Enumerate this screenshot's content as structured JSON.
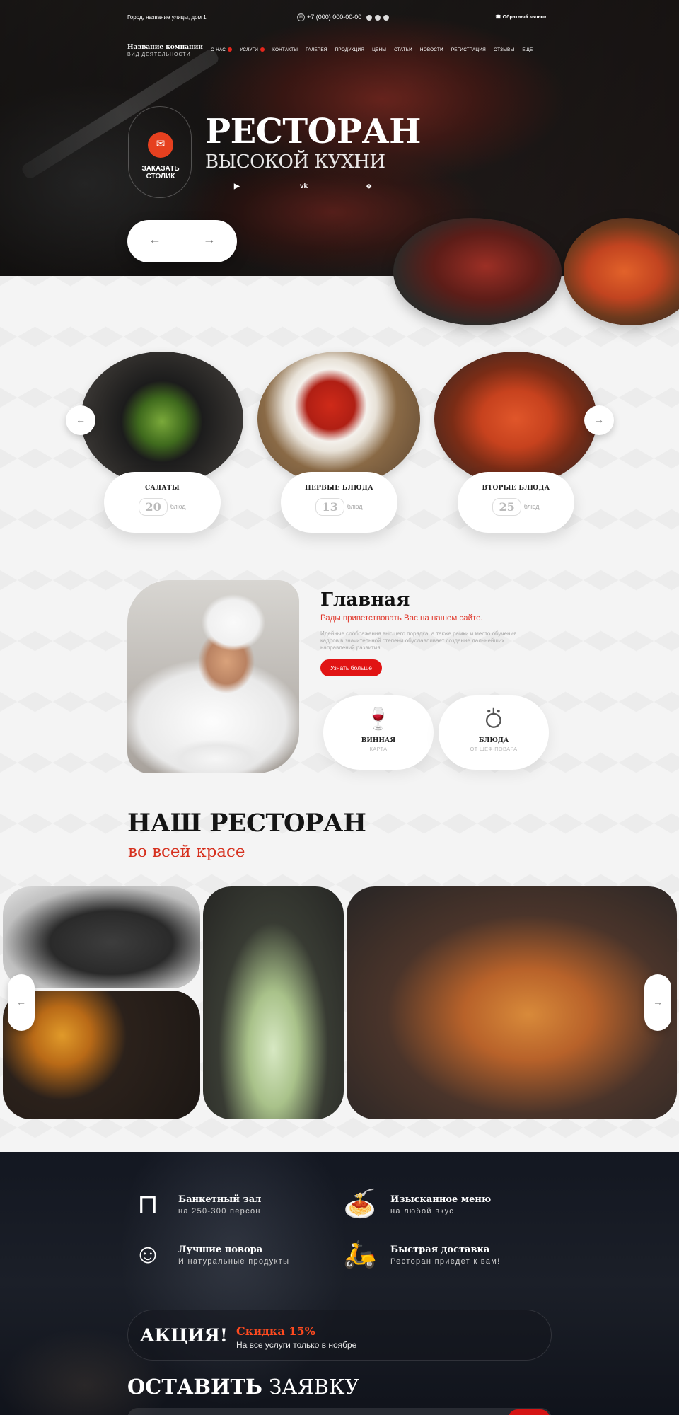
{
  "topbar": {
    "address": "Город, название улицы, дом 1",
    "phone": "+7 (000) 000-00-00",
    "callback": "Обратный звонок"
  },
  "brand": {
    "name": "Название компании",
    "kind": "ВИД ДЕЯТЕЛЬНОСТИ"
  },
  "nav": [
    "О НАС",
    "УСЛУГИ",
    "КОНТАКТЫ",
    "ГАЛЕРЕЯ",
    "ПРОДУКЦИЯ",
    "ЦЕНЫ",
    "СТАТЬИ",
    "НОВОСТИ",
    "РЕГИСТРАЦИЯ",
    "ОТЗЫВЫ",
    "ЕЩЕ"
  ],
  "hero": {
    "order_label": "ЗАКАЗАТЬ СТОЛИК",
    "title": "РЕСТОРАН",
    "subtitle": "ВЫСОКОЙ КУХНИ",
    "socials": [
      "youtube-icon",
      "vk-icon",
      "odnoklassniki-icon"
    ],
    "social_glyphs": [
      "▶",
      "vk",
      "ꝋ"
    ]
  },
  "categories": [
    {
      "title": "САЛАТЫ",
      "count": "20",
      "unit": "блюд"
    },
    {
      "title": "ПЕРВЫЕ БЛЮДА",
      "count": "13",
      "unit": "блюд"
    },
    {
      "title": "ВТОРЫЕ БЛЮДА",
      "count": "25",
      "unit": "блюд"
    }
  ],
  "about": {
    "title": "Главная",
    "subtitle": "Рады приветствовать Вас на нашем сайте.",
    "text": "Идейные соображения высшего порядка, а также рамки и место обучения кадров в значительной степени обуславливает создание дальнейших направлений развития.",
    "button": "Узнать больше",
    "features": [
      {
        "title": "ВИННАЯ",
        "sub": "КАРТА"
      },
      {
        "title": "БЛЮДА",
        "sub": "ОТ ШЕФ-ПОВАРА"
      }
    ]
  },
  "gallery": {
    "title": "НАШ РЕСТОРАН",
    "subtitle": "во всей красе"
  },
  "advantages": [
    {
      "title": "Банкетный зал",
      "sub": "на 250-300 персон",
      "icon": "banquet-table-icon"
    },
    {
      "title": "Изысканное меню",
      "sub": "на любой вкус",
      "icon": "pasta-plate-icon"
    },
    {
      "title": "Лучшие повора",
      "sub": "И натуральные продукты",
      "icon": "chef-icon"
    },
    {
      "title": "Быстрая доставка",
      "sub": "Ресторан приедет к вам!",
      "icon": "delivery-scooter-icon"
    }
  ],
  "promo": {
    "label": "АКЦИЯ!",
    "discount": "Скидка 15%",
    "note": "На все услуги только в ноябре"
  },
  "request": {
    "title_bold": "ОСТАВИТЬ",
    "title_rest": "ЗАЯВКУ"
  },
  "colors": {
    "accent": "#e11414",
    "accent_orange": "#e6401f",
    "dark_bg": "#161a23"
  }
}
